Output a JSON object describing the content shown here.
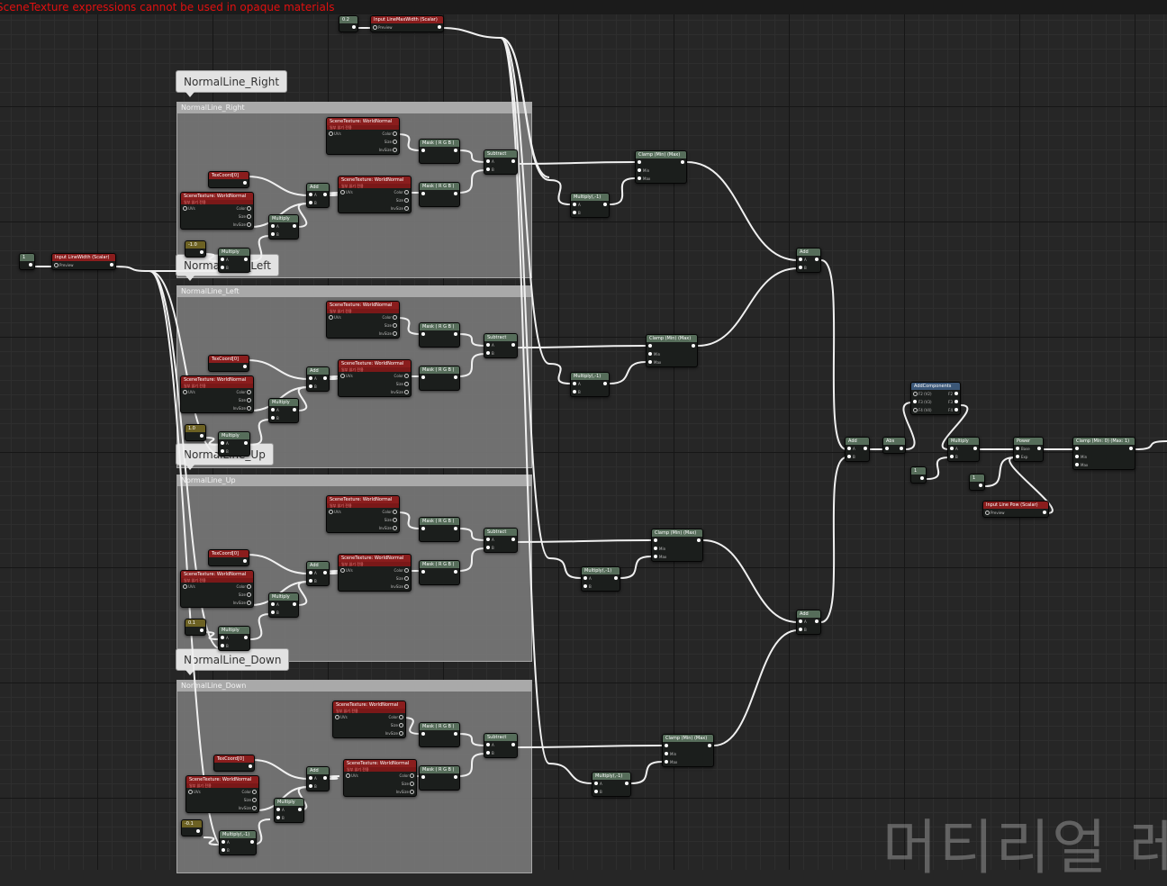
{
  "error_message": "SceneTexture expressions cannot be used in opaque materials",
  "watermark": "머티리얼 레",
  "comment_boxes": [
    {
      "bubble": "NormalLine_Right",
      "title": "NormalLine_Right"
    },
    {
      "bubble": "NormalLine_Left",
      "title": "NormalLine_Left"
    },
    {
      "bubble": "NormalLine_Up",
      "title": "NormalLine_Up"
    },
    {
      "bubble": "NormalLine_Down",
      "title": "NormalLine_Down"
    }
  ],
  "colors": {
    "wire": "#f0f0f0",
    "error": "#e01010",
    "comment_box": "#767676"
  },
  "labels": {
    "scene_texture": "SceneTexture: WorldNormal",
    "scene_texture_sub": "일부 읽기 전용",
    "texcoord": "TexCoord[0]",
    "mask_rgb": "Mask ( R G B )",
    "subtract": "Subtract",
    "add": "Add",
    "multiply": "Multiply",
    "multiply_neg": "Multiply(,-1)",
    "clamp": "Clamp (Min) (Max)",
    "clamp_01": "Clamp (Min: 0) (Max: 1)",
    "abs": "Abs",
    "power": "Power",
    "append": "AddComponents",
    "input_linewidth": "Input LineWidth (Scalar)",
    "input_linemaxwidth": "Input LineMaxWidth (Scalar)",
    "input_linepow": "Input Line Pow (Scalar)",
    "preview": "Preview",
    "uvs": "UVs",
    "color": "Color",
    "size": "Size",
    "invsize": "InvSize",
    "pin_a": "A",
    "pin_b": "B",
    "pin_min": "Min",
    "pin_max": "Max",
    "pin_base": "Base",
    "pin_exp": "Exp",
    "f2": "F2 (V2)",
    "f3": "F3 (V3)",
    "f4": "F4 (V4)",
    "out_f2": "F2",
    "out_f3": "F3",
    "out_f4": "F4"
  },
  "constants": {
    "one": "1",
    "line_max": "0.2",
    "neg_right": "-1.0",
    "neg_left": "1.0",
    "up": "0.1",
    "down": "-0.1"
  }
}
